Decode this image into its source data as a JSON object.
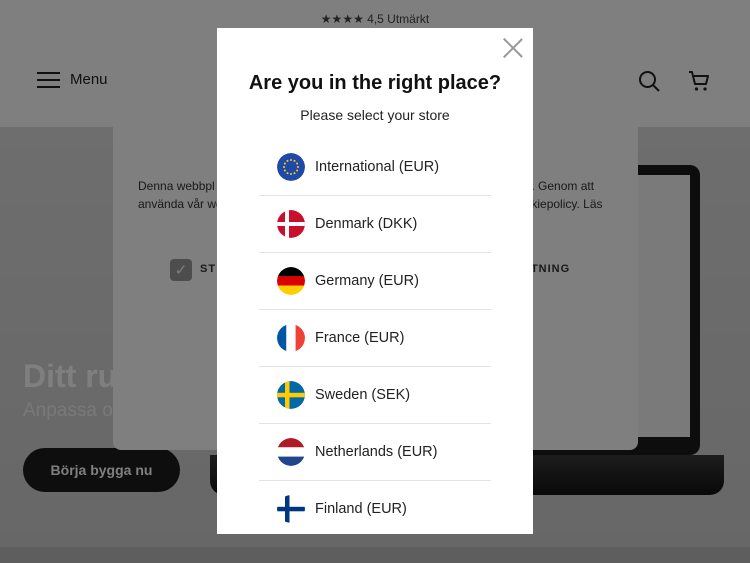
{
  "topbar": {
    "rating_text": "★★★★ 4,5 Utmärkt"
  },
  "header": {
    "menu_label": "Menu"
  },
  "icons": {
    "search": "search-icon",
    "cart": "cart-icon",
    "menu": "hamburger-icon",
    "close": "close-icon"
  },
  "cookie": {
    "text_left": "Denna webbpl använda vår we",
    "text_right": "en. Genom att ookiepolicy. Läs",
    "option_left": "ST",
    "option_right": "KTNING"
  },
  "hero": {
    "title": "Ditt rum. Din",
    "subtitle": "Anpassa o",
    "cta_label": "Börja bygga nu"
  },
  "modal": {
    "title": "Are you in the right place?",
    "subtitle": "Please select your store",
    "stores": [
      {
        "label": "International (EUR)",
        "flag": "eu"
      },
      {
        "label": "Denmark (DKK)",
        "flag": "denmark"
      },
      {
        "label": "Germany (EUR)",
        "flag": "germany"
      },
      {
        "label": "France (EUR)",
        "flag": "france"
      },
      {
        "label": "Sweden (SEK)",
        "flag": "sweden"
      },
      {
        "label": "Netherlands (EUR)",
        "flag": "netherlands"
      },
      {
        "label": "Finland (EUR)",
        "flag": "finland"
      }
    ]
  },
  "colors": {
    "overlay": "#000000",
    "button_dark": "#1c1c1c",
    "eu_blue": "#1f4aa8"
  }
}
